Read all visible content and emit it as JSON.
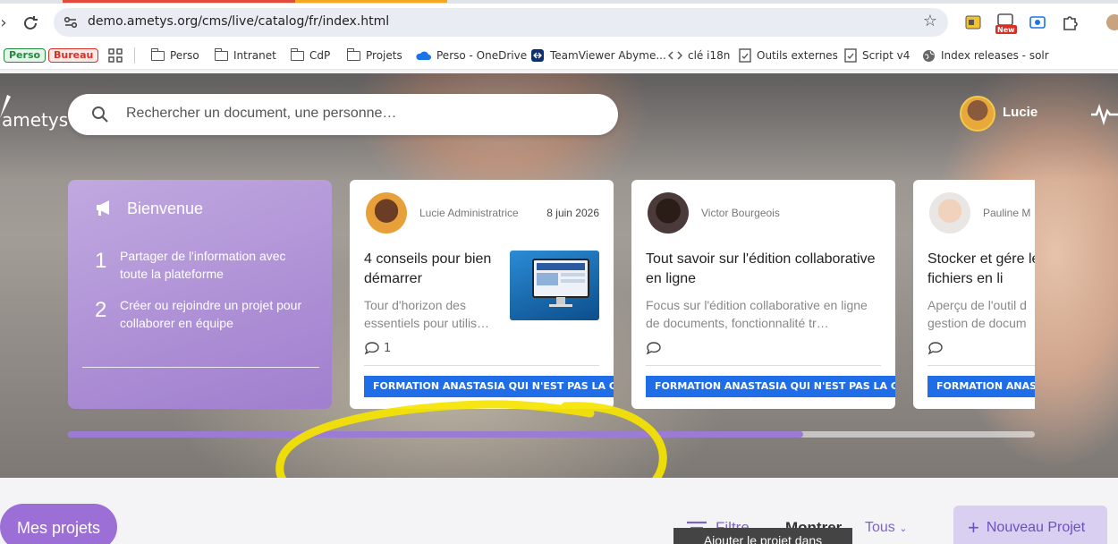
{
  "browser": {
    "url": "demo.ametys.org/cms/live/catalog/fr/index.html",
    "new_badge": "New",
    "bookmarks": [
      {
        "label": "Perso",
        "type": "pill",
        "color": "#1e8e3e"
      },
      {
        "label": "Bureau",
        "type": "pill",
        "color": "#d93025"
      },
      {
        "label": "Perso",
        "type": "folder"
      },
      {
        "label": "Intranet",
        "type": "folder"
      },
      {
        "label": "CdP",
        "type": "folder"
      },
      {
        "label": "Projets",
        "type": "folder"
      },
      {
        "label": "Perso - OneDrive",
        "type": "cloud"
      },
      {
        "label": "TeamViewer Abyme...",
        "type": "teamviewer"
      },
      {
        "label": "clé i18n",
        "type": "code"
      },
      {
        "label": "Outils externes",
        "type": "page"
      },
      {
        "label": "Script  v4",
        "type": "page"
      },
      {
        "label": "Index releases - solr",
        "type": "globe"
      }
    ]
  },
  "header": {
    "logo_text": "ametys",
    "search_placeholder": "Rechercher un document, une personne…",
    "user_name": "Lucie"
  },
  "welcome": {
    "title": "Bienvenue",
    "steps": [
      {
        "num": "1",
        "text": "Partager de l'information avec toute la plateforme"
      },
      {
        "num": "2",
        "text": "Créer ou rejoindre un projet pour collaborer en équipe"
      }
    ]
  },
  "cards": [
    {
      "author": "Lucie Administratrice",
      "date": "8 juin 2026",
      "title": "4 conseils pour bien démarrer",
      "desc": "Tour d'horizon des essentiels pour utilis…",
      "comments": "1",
      "tag": "FORMATION ANASTASIA QUI N'EST PAS LA CAR JAMI"
    },
    {
      "author": "Victor Bourgeois",
      "date": "",
      "title": "Tout savoir sur l'édition collaborative en ligne",
      "desc": "Focus sur l'édition collaborative en ligne de documents, fonctionnalité tr…",
      "comments": "",
      "tag": "FORMATION ANASTASIA QUI N'EST PAS LA CAR JAMI"
    },
    {
      "author": "Pauline M",
      "date": "",
      "title": "Stocker et gére les fichiers en li",
      "desc": "Aperçu de l'outil d gestion de docum",
      "comments": "",
      "tag": "FORMATION ANAST"
    }
  ],
  "carousel_progress": 0.76,
  "bottom": {
    "projects_button": "Mes projets",
    "filter_label": "Filtre",
    "show_label": "Montrer",
    "all_select": "Tous",
    "tooltip": "Ajouter le projet dans",
    "new_project": "Nouveau Projet"
  },
  "colors": {
    "accent": "#9b6fd6",
    "tag_blue": "#1f6ee8",
    "annotation": "#f5e400"
  }
}
